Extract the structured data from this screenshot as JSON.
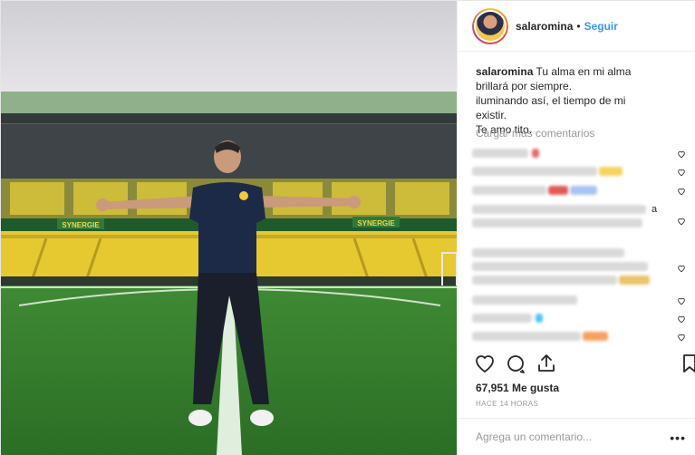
{
  "post": {
    "header": {
      "username": "salaromina",
      "separator": "•",
      "follow_label": "Seguir"
    },
    "caption": {
      "username": "salaromina",
      "lines": [
        "Tu alma en mi alma",
        "brillará por siempre.",
        "iluminando así, el tiempo de mi existir.",
        "Te amo tito."
      ]
    },
    "load_more_comments": "Cargar más comentarios",
    "comments": [
      {
        "blurred": true,
        "accent": "#e06b6b"
      },
      {
        "blurred": true,
        "accent": "#f4d35e"
      },
      {
        "blurred": true,
        "accent": "#e05a5a"
      },
      {
        "blurred": true,
        "trailing_text": "a"
      },
      {
        "blurred": true,
        "accent": "#e9c46a"
      },
      {
        "blurred": true
      },
      {
        "blurred": true,
        "accent": "#4fc3f7"
      },
      {
        "blurred": true,
        "accent": "#f4a261"
      }
    ],
    "icons": {
      "like": "heart-icon",
      "comment": "comment-bubble-icon",
      "share": "share-icon",
      "save": "bookmark-icon",
      "options": "more-options-icon"
    },
    "likes": "67,951 Me gusta",
    "timestamp": "HACE 14 HORAS",
    "add_comment": {
      "placeholder": "Agrega un comentario...",
      "options_label": "•••"
    },
    "photo": {
      "banner_left": "SYNERGIE",
      "banner_right": "SYNERGIE"
    }
  }
}
